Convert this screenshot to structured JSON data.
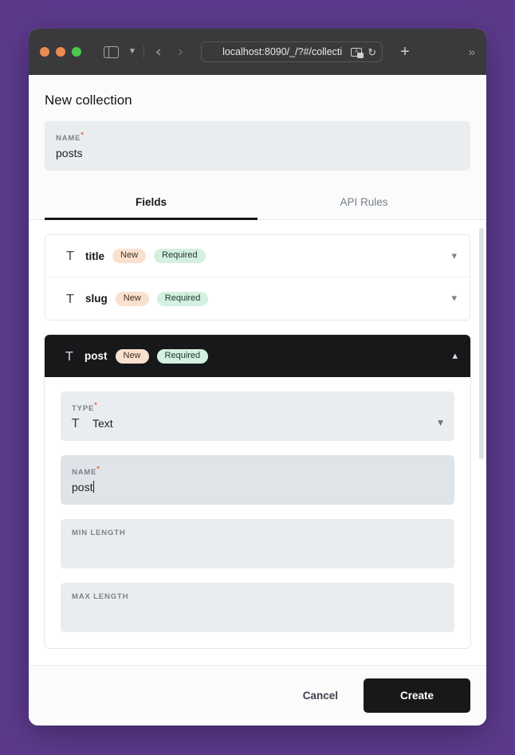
{
  "browser": {
    "url": "localhost:8090/_/?#/collecti",
    "icons": {
      "sidebar": "sidebar-toggle-icon",
      "tab_overview": "chevron-down-icon",
      "back": "‹",
      "forward": "›",
      "translate": "A",
      "reload": "↻",
      "new_tab": "+",
      "overflow": "»"
    },
    "traffic_lights": [
      "close",
      "minimize",
      "maximize"
    ],
    "colors": {
      "close": "#ec8b4f",
      "minimize": "#ec8b4f",
      "maximize": "#4cc94c",
      "toolbar_bg": "#3a3a3c"
    }
  },
  "page": {
    "title": "New collection",
    "desktop_bg": "#5b3a8c"
  },
  "collection_name": {
    "label": "NAME",
    "required_mark": "*",
    "value": "posts",
    "placeholder": ""
  },
  "tabs": [
    {
      "label": "Fields",
      "active": true
    },
    {
      "label": "API Rules",
      "active": false
    }
  ],
  "fields": [
    {
      "type_glyph": "T",
      "name": "title",
      "badges": [
        {
          "label": "New",
          "kind": "new"
        },
        {
          "label": "Required",
          "kind": "required"
        }
      ],
      "chevron": "⌄",
      "expanded": false
    },
    {
      "type_glyph": "T",
      "name": "slug",
      "badges": [
        {
          "label": "New",
          "kind": "new"
        },
        {
          "label": "Required",
          "kind": "required"
        }
      ],
      "chevron": "⌄",
      "expanded": false
    }
  ],
  "expanded_field": {
    "type_glyph": "T",
    "name": "post",
    "badges": [
      {
        "label": "New",
        "kind": "new"
      },
      {
        "label": "Required",
        "kind": "required"
      }
    ],
    "chevron": "⌃",
    "type": {
      "label": "TYPE",
      "required_mark": "*",
      "glyph": "T",
      "value": "Text",
      "caret": "▾"
    },
    "name_field": {
      "label": "NAME",
      "required_mark": "*",
      "value": "post",
      "focused": true
    },
    "min_length": {
      "label": "MIN LENGTH",
      "value": ""
    },
    "max_length": {
      "label": "MAX LENGTH",
      "value": ""
    }
  },
  "badge_colors": {
    "new_bg": "#fae1cf",
    "required_bg": "#d3f0e0"
  },
  "footer": {
    "cancel_label": "Cancel",
    "create_label": "Create",
    "create_bg": "#17181a"
  }
}
